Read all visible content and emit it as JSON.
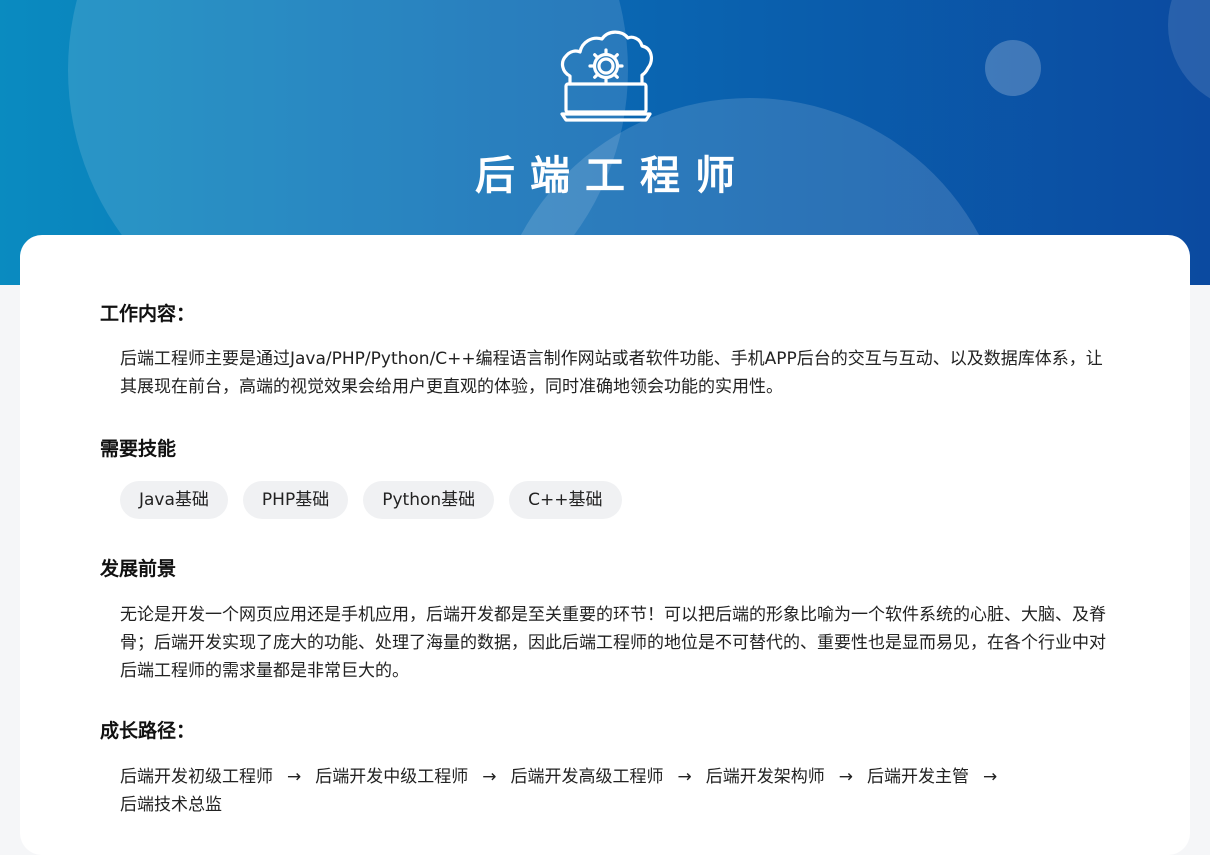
{
  "header": {
    "title": "后端工程师",
    "icon": "cloud-gear-laptop-icon",
    "gradient": [
      "#0a8bc0",
      "#0b4aa0"
    ]
  },
  "sections": {
    "work": {
      "title": "工作内容：",
      "text": "后端工程师主要是通过Java/PHP/Python/C++编程语言制作网站或者软件功能、手机APP后台的交互与互动、以及数据库体系，让其展现在前台，高端的视觉效果会给用户更直观的体验，同时准确地领会功能的实用性。"
    },
    "skills": {
      "title": "需要技能",
      "tags": [
        "Java基础",
        "PHP基础",
        "Python基础",
        "C++基础"
      ]
    },
    "prospect": {
      "title": "发展前景",
      "text": "无论是开发一个网页应用还是手机应用，后端开发都是至关重要的环节！可以把后端的形象比喻为一个软件系统的心脏、大脑、及脊骨；后端开发实现了庞大的功能、处理了海量的数据，因此后端工程师的地位是不可替代的、重要性也是显而易见，在各个行业中对后端工程师的需求量都是非常巨大的。"
    },
    "growth": {
      "title": "成长路径：",
      "steps": [
        "后端开发初级工程师",
        "后端开发中级工程师",
        "后端开发高级工程师",
        "后端开发架构师",
        "后端开发主管",
        "后端技术总监"
      ],
      "arrow": "→"
    }
  }
}
